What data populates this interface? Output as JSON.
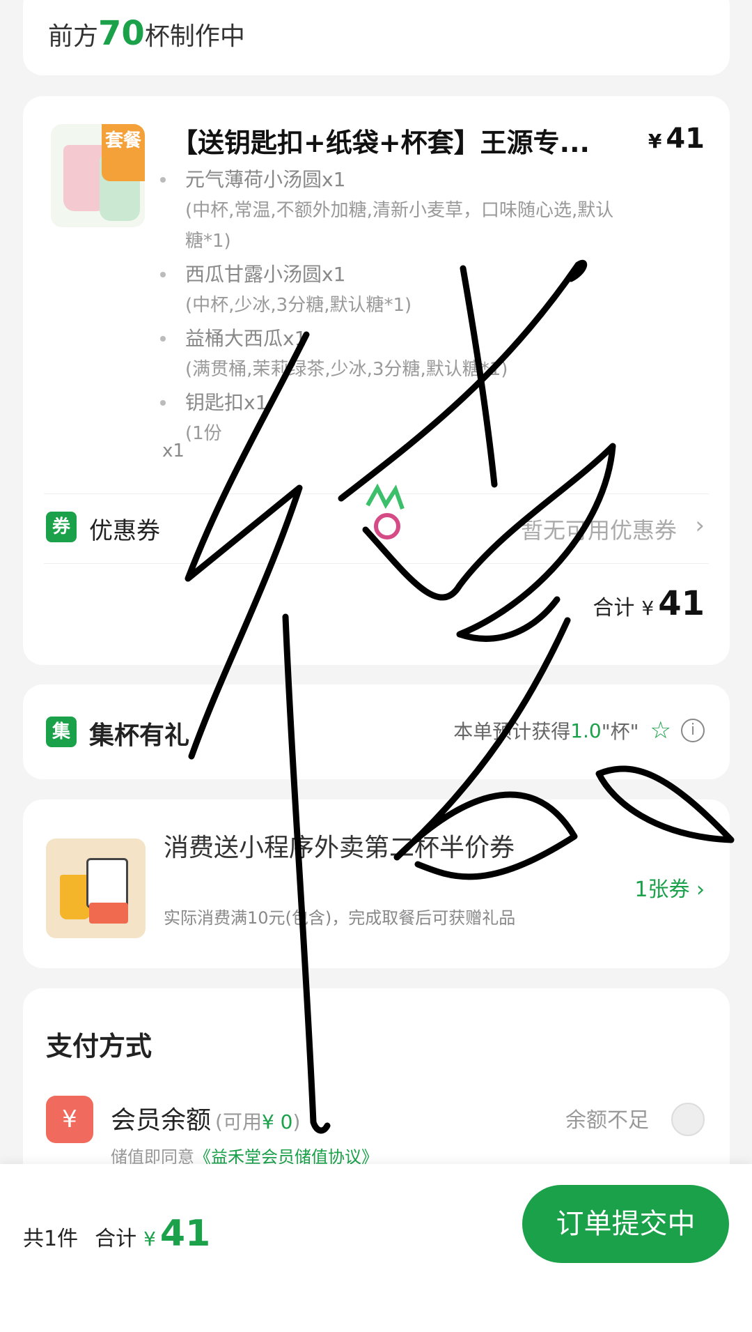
{
  "queue": {
    "prefix": "前方",
    "count": "70",
    "suffix": "杯制作中"
  },
  "order": {
    "tag": "套餐",
    "title": "【送钥匙扣+纸袋+杯套】王源专...",
    "price_symbol": "¥",
    "price": "41",
    "items": [
      {
        "name": "元气薄荷小汤圆x1",
        "spec": "(中杯,常温,不额外加糖,清新小麦草，口味随心选,默认糖*1)"
      },
      {
        "name": "西瓜甘露小汤圆x1",
        "spec": "(中杯,少冰,3分糖,默认糖*1)"
      },
      {
        "name": "益桶大西瓜x1",
        "spec": "(满贯桶,茉莉绿茶,少冰,3分糖,默认糖*1)"
      },
      {
        "name": "钥匙扣x1",
        "spec": "(1份"
      }
    ],
    "quantity": "x1",
    "coupon_icon": "券",
    "coupon_label": "优惠券",
    "coupon_value": "暂无可用优惠券",
    "total_label": "合计",
    "total_symbol": "¥",
    "total": "41"
  },
  "jibei": {
    "icon": "集",
    "label": "集杯有礼",
    "desc_prefix": "本单预计获得",
    "desc_value": "1.0",
    "desc_suffix": "\"杯\""
  },
  "promo": {
    "title": "消费送小程序外卖第二杯半价券",
    "desc": "实际消费满10元(包含)，完成取餐后可获赠礼品",
    "link": "1张券"
  },
  "payment": {
    "title": "支付方式",
    "method_icon": "¥",
    "method_name": "会员余额",
    "avail_prefix": "(可用",
    "avail_value": "¥ 0",
    "avail_suffix": ")",
    "status": "余额不足",
    "agree_prefix": "储值即同意",
    "agree_link": "《益禾堂会员储值协议》"
  },
  "footer": {
    "count": "共1件",
    "total_label": "合计",
    "symbol": "¥",
    "amount": "41",
    "submit": "订单提交中"
  },
  "colors": {
    "accent": "#1aa14a",
    "pay_icon": "#f06a5d",
    "combo_tag": "#f5a13a"
  }
}
